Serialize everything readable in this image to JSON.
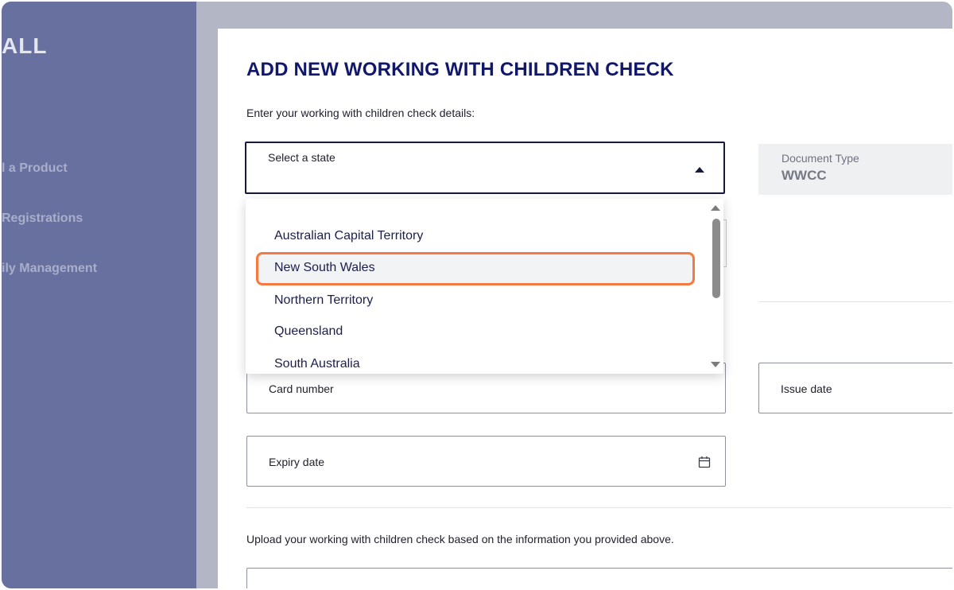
{
  "sidebar": {
    "brand": "ALL",
    "items": [
      {
        "label": "l a Product"
      },
      {
        "label": "Registrations"
      },
      {
        "label": "ily Management"
      }
    ]
  },
  "main": {
    "title": "ADD NEW WORKING WITH CHILDREN CHECK",
    "intro": "Enter your working with children check details:",
    "state_select": {
      "label": "Select a state"
    },
    "document_type": {
      "label": "Document Type",
      "value": "WWCC"
    },
    "card_number": {
      "label": "Card number"
    },
    "issue_date": {
      "label": "Issue date"
    },
    "expiry_date": {
      "label": "Expiry date"
    },
    "upload_text": "Upload your working with children check based on the information you provided above."
  },
  "dropdown": {
    "options": [
      "Australian Capital Territory",
      "New South Wales",
      "Northern Territory",
      "Queensland",
      "South Australia"
    ],
    "highlighted": "New South Wales",
    "highlight_color": "#f47a42"
  },
  "colors": {
    "sidebar": "#68709f",
    "title": "#11186b",
    "accent": "#f47a42"
  }
}
